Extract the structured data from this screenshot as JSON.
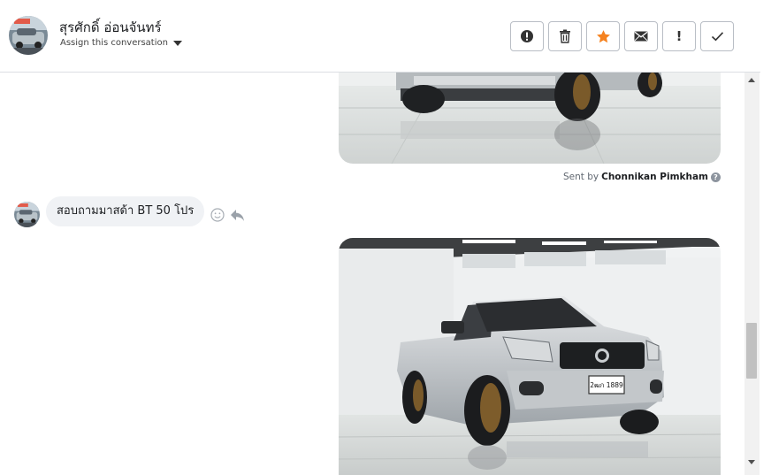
{
  "header": {
    "contact_name": "สุรศักดิ์ อ่อนจันทร์",
    "assign_label": "Assign this conversation",
    "actions": [
      {
        "name": "spam-button",
        "icon": "alert-circle-icon"
      },
      {
        "name": "delete-button",
        "icon": "trash-icon"
      },
      {
        "name": "star-button",
        "icon": "star-icon",
        "color": "#f5821f"
      },
      {
        "name": "email-button",
        "icon": "envelope-icon"
      },
      {
        "name": "important-button",
        "icon": "exclamation-icon",
        "label": "!"
      },
      {
        "name": "done-button",
        "icon": "check-icon"
      }
    ]
  },
  "messages": {
    "sent_by_prefix": "Sent by",
    "sent_by_name": "Chonnikan Pimkham",
    "help_icon": "?",
    "incoming_text": "สอบถามมาสด้า BT 50 โปร",
    "plate_text": "2ฒก 1889"
  },
  "colors": {
    "accent_star": "#f5821f",
    "bubble_bg": "#f0f2f5"
  }
}
